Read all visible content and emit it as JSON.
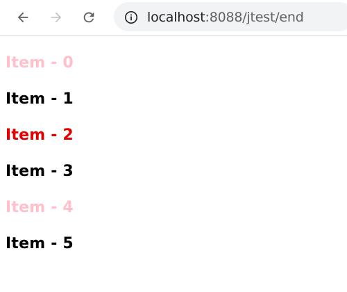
{
  "browser": {
    "url_host": "localhost",
    "url_path": ":8088/jtest/end",
    "icons": {
      "back": "arrow-left-icon",
      "forward": "arrow-right-icon",
      "reload": "reload-icon",
      "info": "info-icon"
    },
    "colors": {
      "icon_active": "#5f6368",
      "icon_disabled": "#c4c7c5",
      "omnibox_bg": "#f1f3f4"
    }
  },
  "items": [
    {
      "label": "Item - 0",
      "color": "#ffc0cb"
    },
    {
      "label": "Item - 1",
      "color": "#000000"
    },
    {
      "label": "Item - 2",
      "color": "#e00000"
    },
    {
      "label": "Item - 3",
      "color": "#000000"
    },
    {
      "label": "Item - 4",
      "color": "#ffc0cb"
    },
    {
      "label": "Item - 5",
      "color": "#000000"
    }
  ]
}
